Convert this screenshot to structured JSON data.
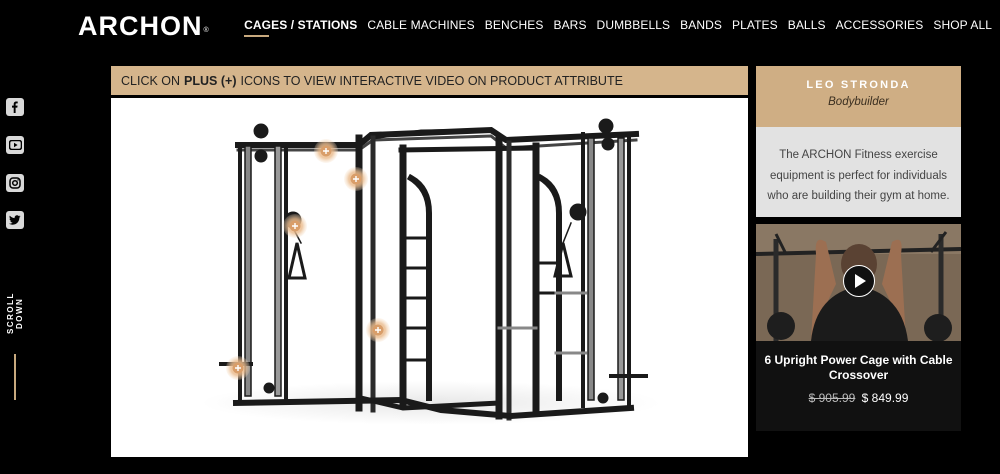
{
  "brand": {
    "logo_text": "ARCHON",
    "registered_mark": "®"
  },
  "nav": {
    "items": [
      {
        "label": "CAGES / STATIONS",
        "active": true
      },
      {
        "label": "CABLE MACHINES"
      },
      {
        "label": "BENCHES"
      },
      {
        "label": "BARS"
      },
      {
        "label": "DUMBBELLS"
      },
      {
        "label": "BANDS"
      },
      {
        "label": "PLATES"
      },
      {
        "label": "BALLS"
      },
      {
        "label": "ACCESSORIES"
      },
      {
        "label": "SHOP ALL"
      }
    ]
  },
  "social": [
    "facebook-icon",
    "youtube-icon",
    "instagram-icon",
    "twitter-icon"
  ],
  "scroll_down": {
    "label": "SCROLL DOWN"
  },
  "banner": {
    "prefix": "CLICK ON",
    "emphasis": "PLUS (+)",
    "suffix": "ICONS TO VIEW INTERACTIVE VIDEO ON PRODUCT ATTRIBUTE"
  },
  "testimonial": {
    "name": "LEO STRONDA",
    "role": "Bodybuilder",
    "quote": "The ARCHON Fitness exercise equipment is perfect for individuals who are building their gym at home."
  },
  "video": {
    "title": "6 Upright Power Cage with Cable Crossover",
    "old_price": "$ 905.99",
    "price": "$ 849.99"
  },
  "colors": {
    "accent": "#c8a97e",
    "banner": "#d5b58c",
    "hotspot": "#e8b98a"
  }
}
